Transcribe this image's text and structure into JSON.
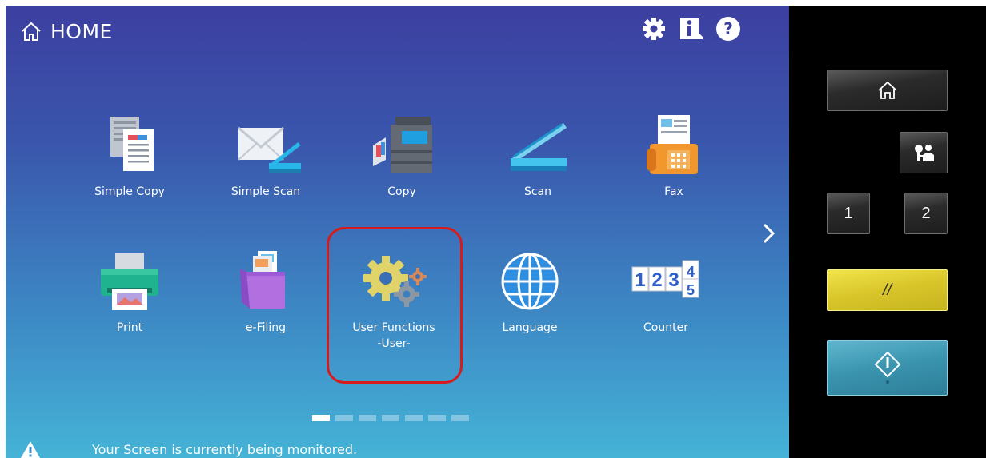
{
  "header": {
    "title": "HOME",
    "icons": [
      "home-icon",
      "settings-gear-icon",
      "info-icon",
      "help-icon"
    ]
  },
  "tiles": [
    {
      "label": "Simple Copy",
      "icon": "document-copy-icon"
    },
    {
      "label": "Simple Scan",
      "icon": "envelope-scan-icon"
    },
    {
      "label": "Copy",
      "icon": "copier-icon"
    },
    {
      "label": "Scan",
      "icon": "scanner-icon"
    },
    {
      "label": "Fax",
      "icon": "fax-icon"
    },
    {
      "label": "Print",
      "icon": "printer-icon"
    },
    {
      "label": "e-Filing",
      "icon": "e-filing-box-icon"
    },
    {
      "label": "User Functions",
      "label2": "-User-",
      "icon": "gears-icon"
    },
    {
      "label": "Language",
      "icon": "globe-icon"
    },
    {
      "label": "Counter",
      "icon": "counter-digits-icon",
      "digits": [
        "1",
        "2",
        "3",
        "4",
        "5"
      ]
    }
  ],
  "pager": {
    "pages": 7,
    "active_index": 0
  },
  "notice": {
    "text": "Your Screen is currently being monitored.",
    "icon": "warning-icon"
  },
  "hardware_panel": {
    "buttons": [
      {
        "name": "home-hw-button",
        "icon": "home-outline-icon"
      },
      {
        "name": "user-access-button",
        "icon": "user-key-icon"
      },
      {
        "name": "memory-1-button",
        "label": "1"
      },
      {
        "name": "memory-2-button",
        "label": "2"
      },
      {
        "name": "reset-button",
        "label": "//"
      },
      {
        "name": "start-button",
        "icon": "start-diamond-icon"
      }
    ]
  },
  "colors": {
    "screen_top": "#3c3fa0",
    "screen_bottom": "#45b3d6",
    "highlight": "#d81a1a",
    "reset_yellow": "#d8c52a",
    "start_blue": "#3a93ad"
  }
}
